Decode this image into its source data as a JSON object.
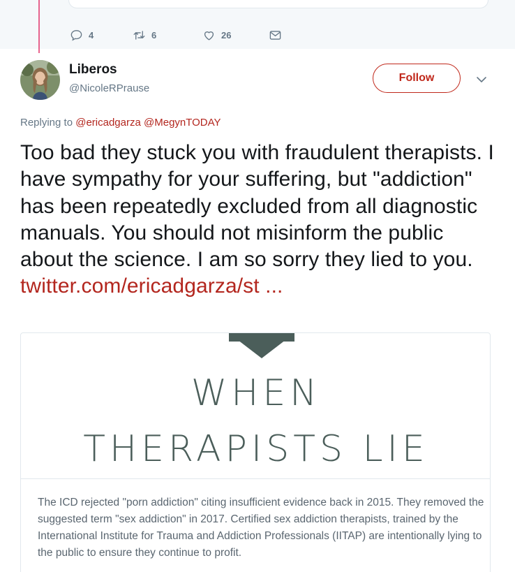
{
  "previous_tweet": {
    "actions": {
      "reply_count": "4",
      "retweet_count": "6",
      "like_count": "26"
    }
  },
  "tweet": {
    "display_name": "Liberos",
    "handle": "@NicoleRPrause",
    "follow_label": "Follow",
    "replying_prefix": "Replying to",
    "replying_to": [
      "@ericadgarza",
      "@MegynTODAY"
    ],
    "text": "Too bad they stuck you with fraudulent therapists. I have sympathy for your suffering, but \"addiction\" has been repeatedly excluded from all diagnostic manuals. You should not misinform the public about the science. I am so sorry they lied to you.",
    "link": "twitter.com/ericadgarza/st ..."
  },
  "card": {
    "title_line1": "WHEN",
    "title_line2": "THERAPISTS LIE",
    "body": "The ICD rejected \"porn addiction\" citing insufficient evidence back in 2015. They removed the suggested term \"sex addiction\" in 2017. Certified sex addiction therapists, trained by the International Institute for Trauma and Addiction Professionals (IITAP) are intentionally lying to the public to ensure they continue to profit."
  },
  "colors": {
    "accent": "#b3261e",
    "muted": "#657786",
    "card_title": "#4b5e5a"
  }
}
